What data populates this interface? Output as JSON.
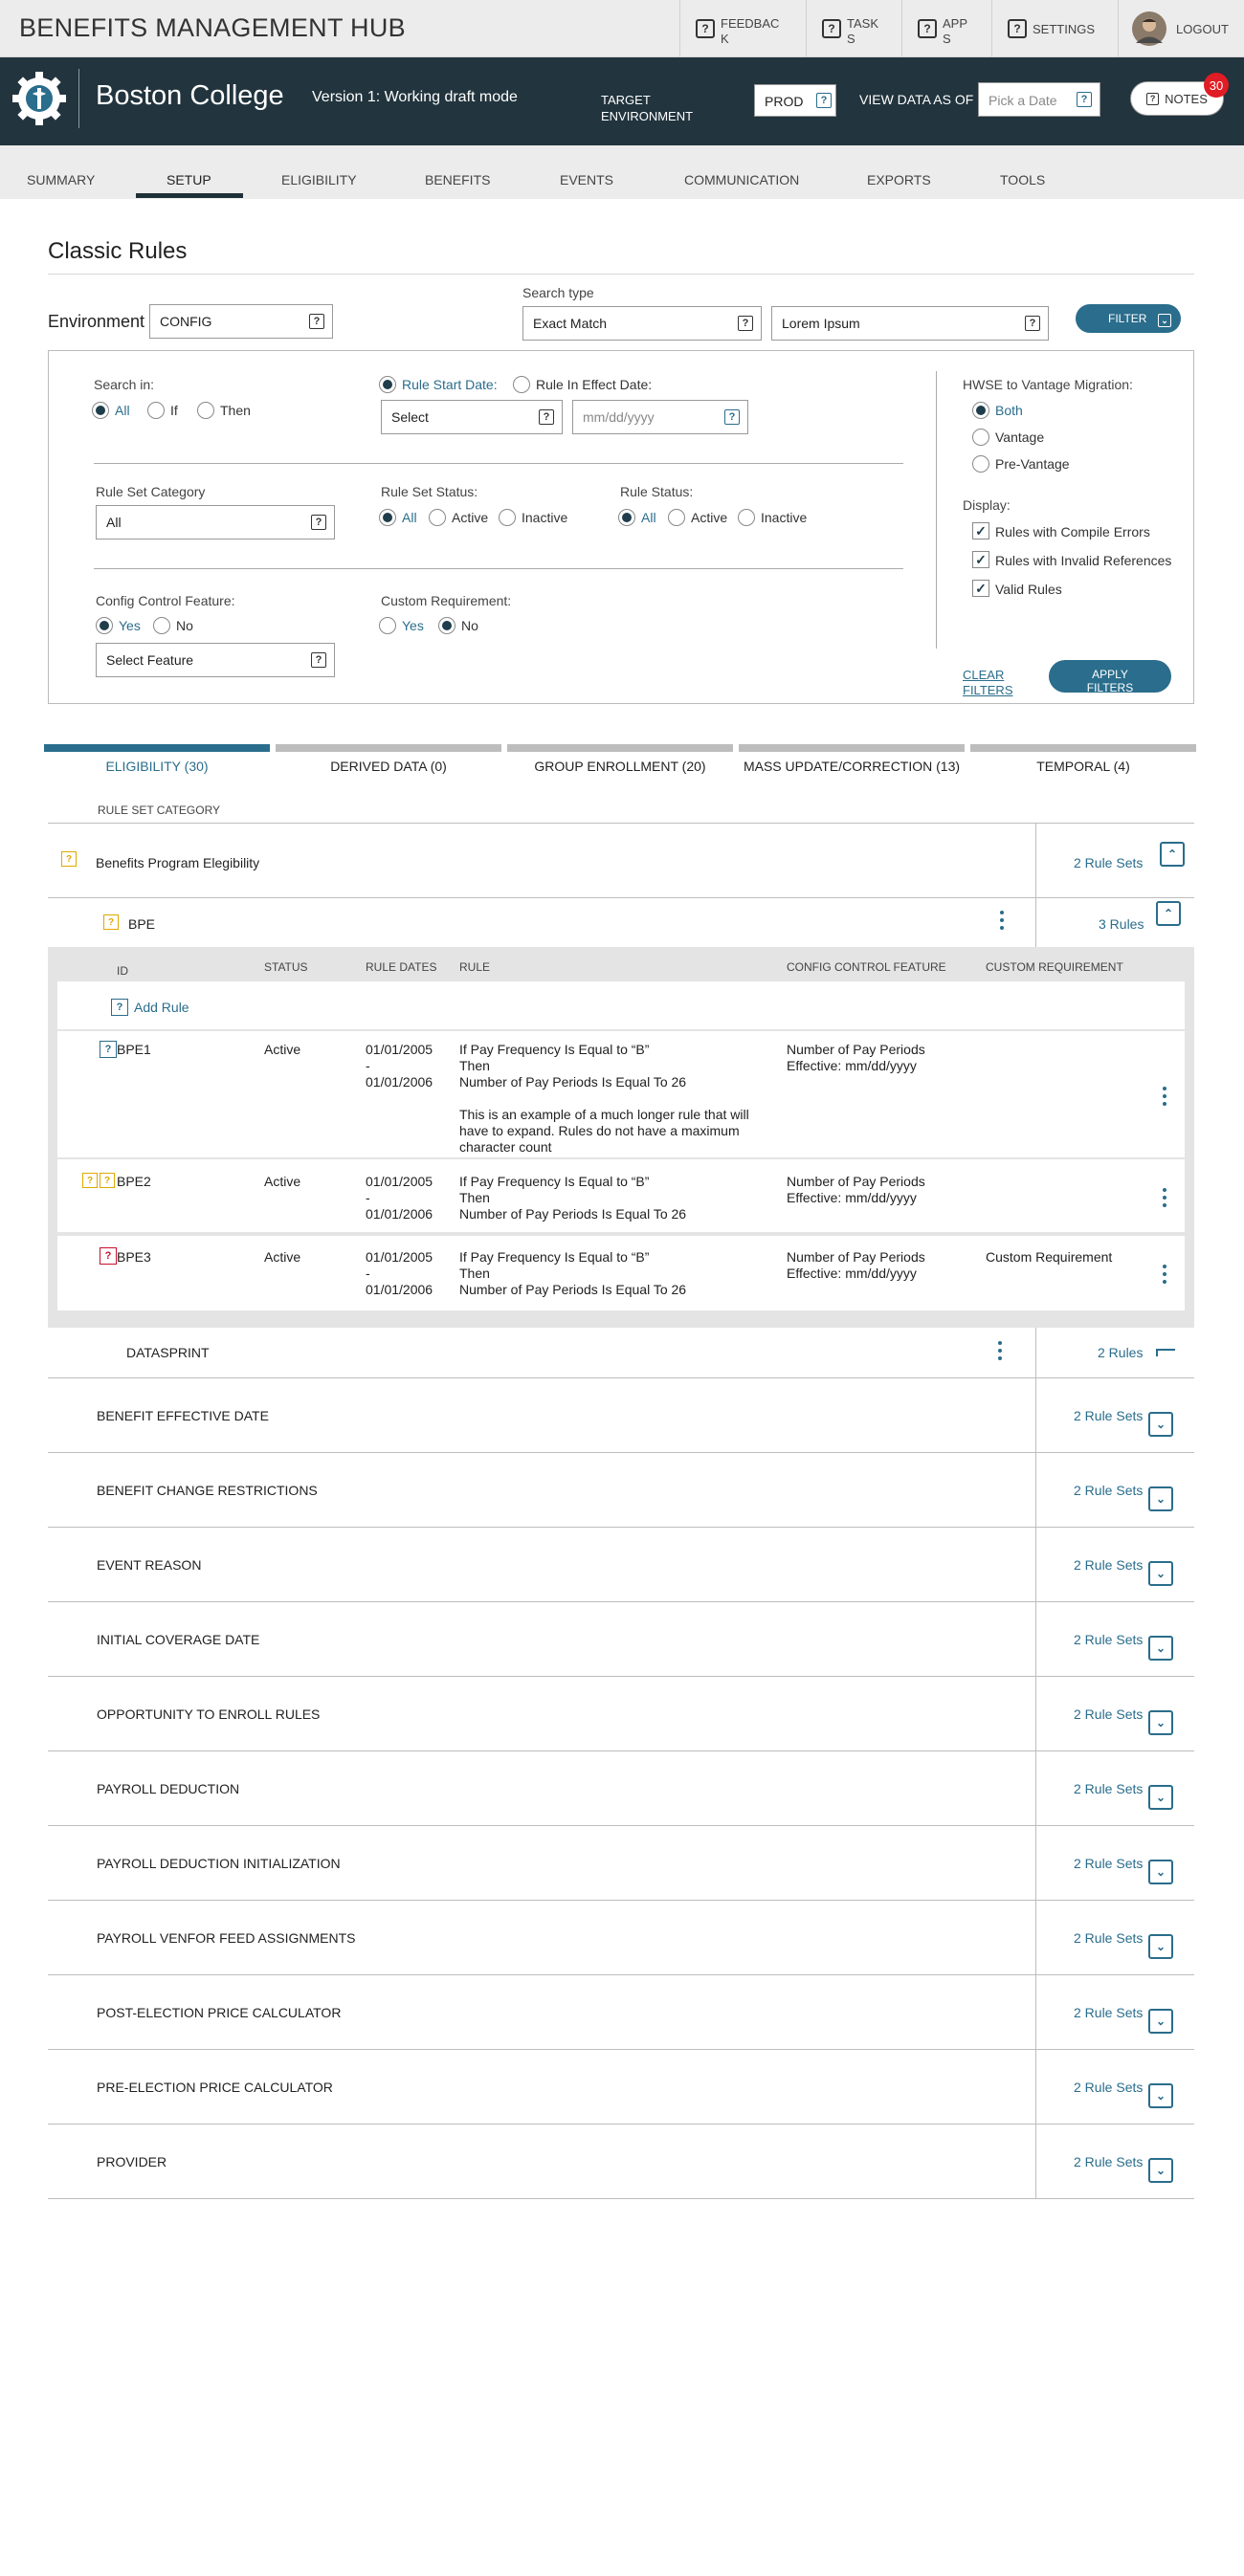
{
  "header": {
    "app_title": "BENEFITS MANAGEMENT HUB",
    "buttons": [
      {
        "label": "FEEDBACK",
        "line1": "FEEDBAC",
        "line2": "K"
      },
      {
        "label": "TASKS",
        "line1": "TASK",
        "line2": "S"
      },
      {
        "label": "APPS",
        "line1": "APP",
        "line2": "S"
      },
      {
        "label": "SETTINGS"
      },
      {
        "label": "LOGOUT"
      }
    ]
  },
  "client_bar": {
    "client_name": "Boston College",
    "version": "Version 1:  Working  draft mode",
    "target_env_label_1": "TARGET",
    "target_env_label_2": "ENVIRONMENT",
    "target_env_value": "PROD",
    "view_data_label": "VIEW DATA AS OF",
    "date_placeholder": "Pick a Date",
    "notes_label": "NOTES",
    "notes_count": "30"
  },
  "nav": {
    "tabs": [
      "SUMMARY",
      "SETUP",
      "ELIGIBILITY",
      "BENEFITS",
      "EVENTS",
      "COMMUNICATION",
      "EXPORTS",
      "TOOLS"
    ],
    "active": "SETUP"
  },
  "page": {
    "title": "Classic Rules",
    "environment_label": "Environment",
    "environment_value": "CONFIG",
    "search_type_label": "Search type",
    "search_type_value": "Exact Match",
    "search_text": "Lorem Ipsum",
    "filter_label": "FILTER"
  },
  "filters": {
    "search_in_label": "Search in:",
    "search_in_options": [
      "All",
      "If",
      "Then"
    ],
    "rule_start_date": "Rule Start Date:",
    "rule_in_effect_date": "Rule In Effect Date:",
    "date_select": "Select",
    "date_placeholder": "mm/dd/yyyy",
    "rule_set_category_label": "Rule Set Category",
    "rule_set_category_value": "All",
    "rule_set_status_label": "Rule Set Status:",
    "rule_status_label": "Rule Status:",
    "status_options": [
      "All",
      "Active",
      "Inactive"
    ],
    "config_control_label": "Config Control Feature:",
    "yes": "Yes",
    "no": "No",
    "select_feature": "Select Feature",
    "custom_req_label": "Custom Requirement:",
    "hwse_label": "HWSE to Vantage Migration:",
    "hwse_options": [
      "Both",
      "Vantage",
      "Pre-Vantage"
    ],
    "display_label": "Display:",
    "display_options": [
      "Rules with Compile Errors",
      "Rules with Invalid References",
      "Valid Rules"
    ],
    "clear_1": "CLEAR",
    "clear_2": "FILTERS",
    "apply_1": "APPLY",
    "apply_2": "FILTERS"
  },
  "result_tabs": [
    "ELIGIBILITY (30)",
    "DERIVED DATA (0)",
    "GROUP ENROLLMENT (20)",
    "MASS UPDATE/CORRECTION (13)",
    "TEMPORAL (4)"
  ],
  "table": {
    "header": "RULE SET CATEGORY",
    "category": "Benefits Program Elegibility",
    "category_count": "2 Rule Sets",
    "ruleset": "BPE",
    "ruleset_count": "3 Rules",
    "columns": [
      "ID",
      "STATUS",
      "RULE DATES",
      "RULE",
      "CONFIG CONTROL FEATURE",
      "CUSTOM REQUIREMENT"
    ],
    "add_rule": "Add Rule",
    "rules": [
      {
        "id": "BPE1",
        "status": "Active",
        "date_start": "01/01/2005",
        "dash": "-",
        "date_end": "01/01/2006",
        "rule_lines": [
          "If Pay Frequency Is Equal to “B”",
          "Then",
          "Number of Pay Periods Is Equal To 26",
          "",
          "This is an example of a much longer rule that will",
          "have to expand. Rules do not have a maximum",
          "character count"
        ],
        "config_1": "Number of Pay Periods",
        "config_2": "Effective: mm/dd/yyyy",
        "custom": ""
      },
      {
        "id": "BPE2",
        "status": "Active",
        "date_start": "01/01/2005",
        "dash": "-",
        "date_end": "01/01/2006",
        "rule_lines": [
          "If Pay Frequency Is Equal to “B”",
          "Then",
          "Number of Pay Periods Is Equal To 26"
        ],
        "config_1": "Number of Pay Periods",
        "config_2": "Effective: mm/dd/yyyy",
        "custom": ""
      },
      {
        "id": "BPE3",
        "status": "Active",
        "date_start": "01/01/2005",
        "dash": "-",
        "date_end": "01/01/2006",
        "rule_lines": [
          "If Pay Frequency Is Equal to “B”",
          "Then",
          "Number of Pay Periods Is Equal To 26"
        ],
        "config_1": "Number of Pay Periods",
        "config_2": "Effective: mm/dd/yyyy",
        "custom": "Custom Requirement"
      }
    ],
    "dataset": "DATASPRINT",
    "dataset_count": "2 Rules",
    "categories": [
      {
        "name": "BENEFIT EFFECTIVE DATE",
        "count": "2 Rule Sets"
      },
      {
        "name": "BENEFIT CHANGE RESTRICTIONS",
        "count": "2 Rule Sets"
      },
      {
        "name": "EVENT REASON",
        "count": "2 Rule Sets"
      },
      {
        "name": "INITIAL COVERAGE DATE",
        "count": "2 Rule Sets"
      },
      {
        "name": "OPPORTUNITY TO ENROLL RULES",
        "count": "2 Rule Sets"
      },
      {
        "name": "PAYROLL DEDUCTION",
        "count": "2 Rule Sets"
      },
      {
        "name": "PAYROLL DEDUCTION INITIALIZATION",
        "count": "2 Rule Sets"
      },
      {
        "name": "PAYROLL VENFOR FEED ASSIGNMENTS",
        "count": "2 Rule Sets"
      },
      {
        "name": "POST-ELECTION PRICE CALCULATOR",
        "count": "2 Rule Sets"
      },
      {
        "name": "PRE-ELECTION PRICE CALCULATOR",
        "count": "2 Rule Sets"
      },
      {
        "name": "PROVIDER",
        "count": "2 Rule Sets"
      }
    ]
  },
  "colors": {
    "dark": "#22343d",
    "accent": "#2a6d8c",
    "badge": "#e01c24",
    "warning": "#e0a800",
    "error": "#c8102e"
  },
  "icons": [
    "question-icon",
    "gear-logo-icon",
    "avatar",
    "notes-icon",
    "filter-icon",
    "expand-icon",
    "collapse-icon",
    "kebab-icon",
    "warning-icon",
    "error-icon",
    "checkmark-icon"
  ]
}
